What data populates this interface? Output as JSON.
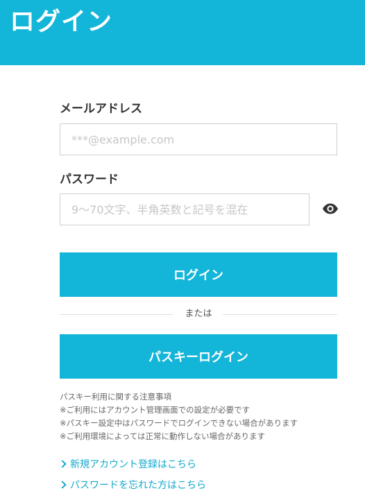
{
  "header": {
    "title": "ログイン"
  },
  "form": {
    "email": {
      "label": "メールアドレス",
      "placeholder": "***@example.com",
      "value": ""
    },
    "password": {
      "label": "パスワード",
      "placeholder": "9〜70文字、半角英数と記号を混在",
      "value": "",
      "toggle_icon": "eye-icon"
    },
    "login_button_label": "ログイン",
    "divider_text": "または",
    "passkey_button_label": "パスキーログイン"
  },
  "notes": [
    "パスキー利用に関する注意事項",
    "※ご利用にはアカウント管理画面での設定が必要です",
    "※パスキー設定中はパスワードでログインできない場合があります",
    "※ご利用環境によっては正常に動作しない場合があります"
  ],
  "links": {
    "register": "新規アカウント登録はこちら",
    "forgot_password": "パスワードを忘れた方はこちら"
  },
  "colors": {
    "accent": "#13b5d8",
    "link": "#13a9cc"
  }
}
